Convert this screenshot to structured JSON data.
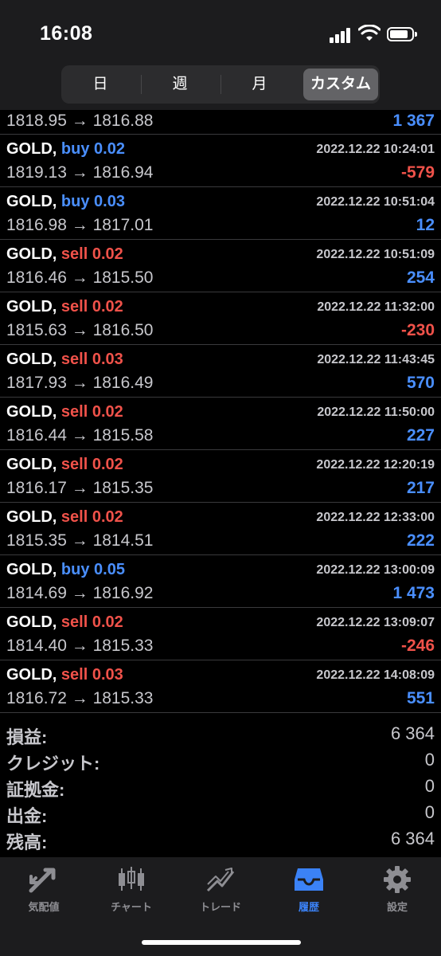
{
  "status_bar": {
    "time": "16:08"
  },
  "period_tabs": [
    {
      "label": "日",
      "active": false
    },
    {
      "label": "週",
      "active": false
    },
    {
      "label": "月",
      "active": false
    },
    {
      "label": "カスタム",
      "active": true
    }
  ],
  "first_row": {
    "prices": "1818.95 → 1816.88",
    "profit": "1 367"
  },
  "trades": [
    {
      "symbol": "GOLD,",
      "side": "buy 0.02",
      "datetime": "2022.12.22 10:24:01",
      "prices": "1819.13 → 1816.94",
      "profit": "-579"
    },
    {
      "symbol": "GOLD,",
      "side": "buy 0.03",
      "datetime": "2022.12.22 10:51:04",
      "prices": "1816.98 → 1817.01",
      "profit": "12"
    },
    {
      "symbol": "GOLD,",
      "side": "sell 0.02",
      "datetime": "2022.12.22 10:51:09",
      "prices": "1816.46 → 1815.50",
      "profit": "254"
    },
    {
      "symbol": "GOLD,",
      "side": "sell 0.02",
      "datetime": "2022.12.22 11:32:00",
      "prices": "1815.63 → 1816.50",
      "profit": "-230"
    },
    {
      "symbol": "GOLD,",
      "side": "sell 0.03",
      "datetime": "2022.12.22 11:43:45",
      "prices": "1817.93 → 1816.49",
      "profit": "570"
    },
    {
      "symbol": "GOLD,",
      "side": "sell 0.02",
      "datetime": "2022.12.22 11:50:00",
      "prices": "1816.44 → 1815.58",
      "profit": "227"
    },
    {
      "symbol": "GOLD,",
      "side": "sell 0.02",
      "datetime": "2022.12.22 12:20:19",
      "prices": "1816.17 → 1815.35",
      "profit": "217"
    },
    {
      "symbol": "GOLD,",
      "side": "sell 0.02",
      "datetime": "2022.12.22 12:33:00",
      "prices": "1815.35 → 1814.51",
      "profit": "222"
    },
    {
      "symbol": "GOLD,",
      "side": "buy 0.05",
      "datetime": "2022.12.22 13:00:09",
      "prices": "1814.69 → 1816.92",
      "profit": "1 473"
    },
    {
      "symbol": "GOLD,",
      "side": "sell 0.02",
      "datetime": "2022.12.22 13:09:07",
      "prices": "1814.40 → 1815.33",
      "profit": "-246"
    },
    {
      "symbol": "GOLD,",
      "side": "sell 0.03",
      "datetime": "2022.12.22 14:08:09",
      "prices": "1816.72 → 1815.33",
      "profit": "551"
    }
  ],
  "summary": {
    "profit_label": "損益:",
    "profit_value": "6 364",
    "credit_label": "クレジット:",
    "credit_value": "0",
    "deposit_label": "証拠金:",
    "deposit_value": "0",
    "withdrawal_label": "出金:",
    "withdrawal_value": "0",
    "balance_label": "残高:",
    "balance_value": "6 364"
  },
  "tabbar": [
    {
      "label": "気配値",
      "icon": "quotes-icon",
      "active": false
    },
    {
      "label": "チャート",
      "icon": "chart-icon",
      "active": false
    },
    {
      "label": "トレード",
      "icon": "trade-icon",
      "active": false
    },
    {
      "label": "履歴",
      "icon": "history-icon",
      "active": true
    },
    {
      "label": "設定",
      "icon": "settings-icon",
      "active": false
    }
  ],
  "colors": {
    "buy": "#4a8fff",
    "sell": "#f0524a",
    "profit_positive": "#4a8fff",
    "profit_negative": "#f0524a",
    "active_tab": "#3b82f6",
    "background": "#000000"
  }
}
